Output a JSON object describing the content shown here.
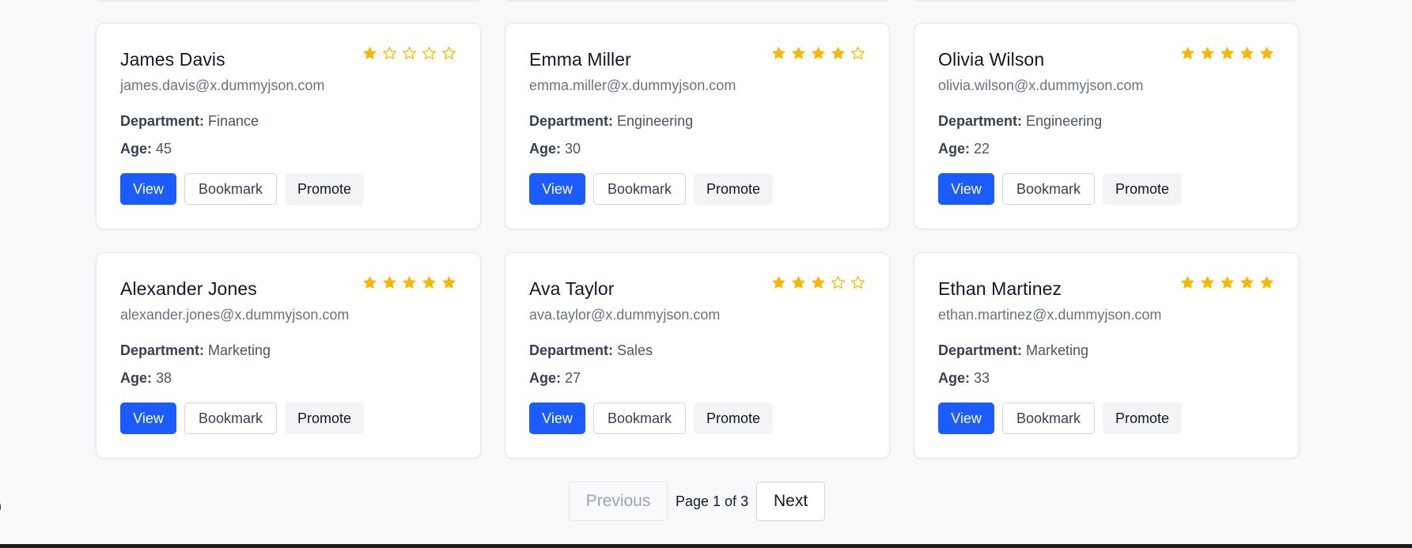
{
  "labels": {
    "department": "Department:",
    "age": "Age:",
    "view": "View",
    "bookmark": "Bookmark",
    "promote": "Promote"
  },
  "colors": {
    "accent": "#1a5cff",
    "star": "#f5b800"
  },
  "employees": [
    {
      "name": "James Davis",
      "email": "james.davis@x.dummyjson.com",
      "department": "Finance",
      "age": "45",
      "rating": 1
    },
    {
      "name": "Emma Miller",
      "email": "emma.miller@x.dummyjson.com",
      "department": "Engineering",
      "age": "30",
      "rating": 4
    },
    {
      "name": "Olivia Wilson",
      "email": "olivia.wilson@x.dummyjson.com",
      "department": "Engineering",
      "age": "22",
      "rating": 5
    },
    {
      "name": "Alexander Jones",
      "email": "alexander.jones@x.dummyjson.com",
      "department": "Marketing",
      "age": "38",
      "rating": 5
    },
    {
      "name": "Ava Taylor",
      "email": "ava.taylor@x.dummyjson.com",
      "department": "Sales",
      "age": "27",
      "rating": 3
    },
    {
      "name": "Ethan Martinez",
      "email": "ethan.martinez@x.dummyjson.com",
      "department": "Marketing",
      "age": "33",
      "rating": 5
    }
  ],
  "pagination": {
    "previous": "Previous",
    "page_info": "Page 1 of 3",
    "next": "Next",
    "current_page": 1,
    "total_pages": 3
  }
}
